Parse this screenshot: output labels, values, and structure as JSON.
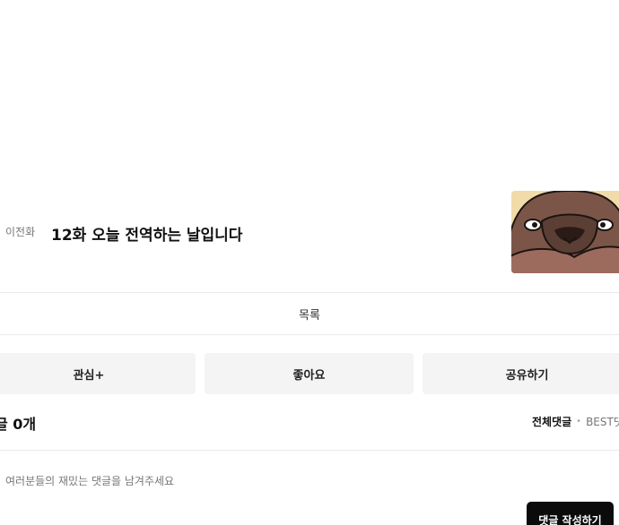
{
  "episode": {
    "prev_label": "이전화",
    "title": "12화 오늘 전역하는 날입니다"
  },
  "list_button": "목록",
  "actions": {
    "interest": "관심+",
    "like": "좋아요",
    "share": "공유하기"
  },
  "comments": {
    "count_label": "글 0개",
    "filter_all": "전체댓글",
    "filter_separator": "•",
    "filter_best": "BEST댓",
    "input_placeholder": "여러분들의 재밌는 댓글을 남겨주세요",
    "submit_label": "댓글 작성하기"
  },
  "colors": {
    "thumbnail_bg": "#f1dba8",
    "submit_bg": "#0b0b0b",
    "action_bg": "#f4f4f4"
  }
}
